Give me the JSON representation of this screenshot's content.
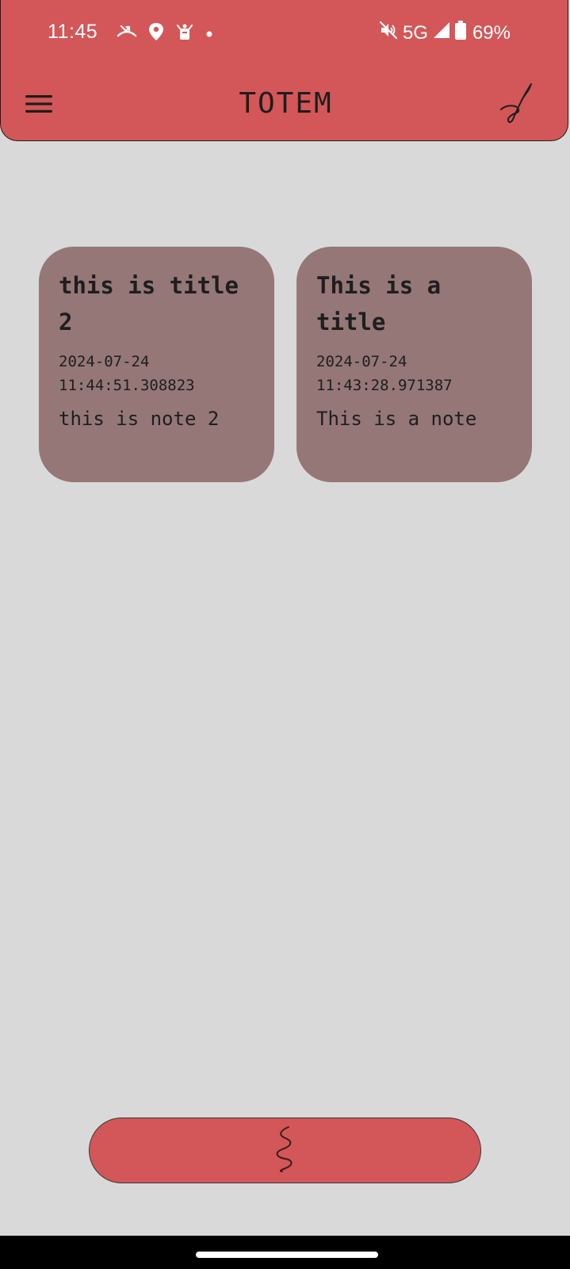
{
  "status_bar": {
    "time": "11:45",
    "network": "5G",
    "battery": "69%",
    "left_icons": [
      "missed-call-icon",
      "maps-icon",
      "delivery-icon",
      "notification-dot-icon"
    ],
    "right_icons": [
      "mute-icon",
      "signal-icon",
      "battery-icon"
    ]
  },
  "header": {
    "title": "TOTEM",
    "menu_icon": "hamburger-menu-icon",
    "action_icon": "signature-icon"
  },
  "notes": [
    {
      "title": "this is title 2",
      "timestamp": "2024-07-24 11:44:51.308823",
      "body": "this is note 2"
    },
    {
      "title": "This is a title",
      "timestamp": "2024-07-24 11:43:28.971387",
      "body": "This is a note"
    }
  ],
  "fab": {
    "icon": "squiggle-icon"
  },
  "colors": {
    "header": "#d35758",
    "background": "#d9d9d9",
    "card": "#957778",
    "text": "#1e1e1e"
  }
}
